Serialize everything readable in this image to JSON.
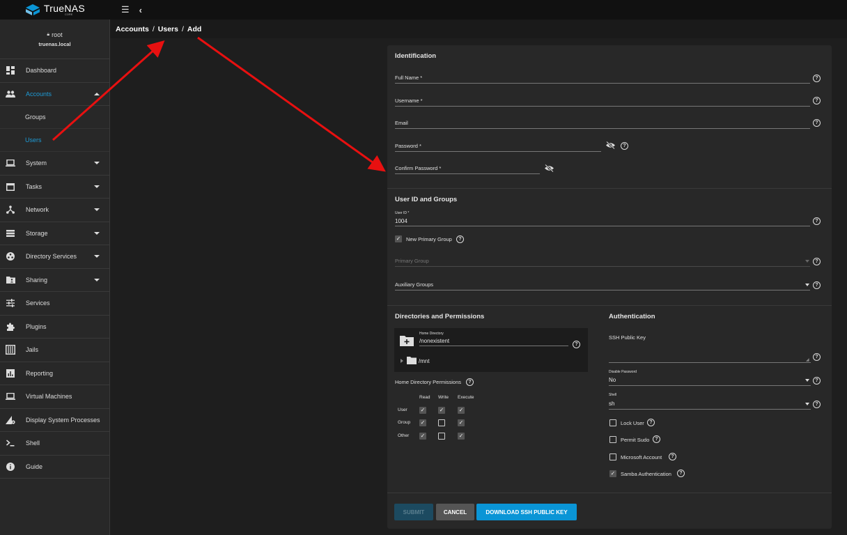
{
  "app": {
    "name": "TrueNAS",
    "edition": "CORE"
  },
  "user": {
    "name": "root",
    "host": "truenas.local"
  },
  "breadcrumb": [
    "Accounts",
    "Users",
    "Add"
  ],
  "sidebar": {
    "items": [
      {
        "label": "Dashboard",
        "icon": "dashboard-icon"
      },
      {
        "label": "Accounts",
        "icon": "people-icon",
        "expanded": true,
        "active": true
      },
      {
        "label": "System",
        "icon": "laptop-icon"
      },
      {
        "label": "Tasks",
        "icon": "calendar-icon"
      },
      {
        "label": "Network",
        "icon": "network-icon"
      },
      {
        "label": "Storage",
        "icon": "storage-icon"
      },
      {
        "label": "Directory Services",
        "icon": "directory-icon"
      },
      {
        "label": "Sharing",
        "icon": "folder-share-icon"
      },
      {
        "label": "Services",
        "icon": "tune-icon"
      },
      {
        "label": "Plugins",
        "icon": "puzzle-icon"
      },
      {
        "label": "Jails",
        "icon": "jail-icon"
      },
      {
        "label": "Reporting",
        "icon": "chart-icon"
      },
      {
        "label": "Virtual Machines",
        "icon": "monitor-icon"
      },
      {
        "label": "Display System Processes",
        "icon": "processes-icon"
      },
      {
        "label": "Shell",
        "icon": "terminal-icon"
      },
      {
        "label": "Guide",
        "icon": "info-icon"
      }
    ],
    "accounts_sub": [
      "Groups",
      "Users"
    ]
  },
  "form": {
    "identification": {
      "title": "Identification",
      "full_name": "Full Name *",
      "username": "Username *",
      "email": "Email",
      "password": "Password *",
      "confirm_password": "Confirm Password *"
    },
    "ids": {
      "title": "User ID and Groups",
      "user_id_label": "User ID *",
      "user_id_value": "1004",
      "new_primary_group": "New Primary Group",
      "primary_group": "Primary Group",
      "auxiliary_groups": "Auxiliary Groups"
    },
    "directories": {
      "title": "Directories and Permissions",
      "home_dir_label": "Home Directory",
      "home_dir_value": "/nonexistent",
      "tree_root": "/mnt",
      "perm_title": "Home Directory Permissions",
      "perm_cols": [
        "Read",
        "Write",
        "Execute"
      ],
      "perm_rows": [
        {
          "name": "User",
          "read": true,
          "write": true,
          "execute": true
        },
        {
          "name": "Group",
          "read": true,
          "write": false,
          "execute": true
        },
        {
          "name": "Other",
          "read": true,
          "write": false,
          "execute": true
        }
      ]
    },
    "auth": {
      "title": "Authentication",
      "ssh_key_label": "SSH Public Key",
      "disable_password_label": "Disable Password",
      "disable_password_value": "No",
      "shell_label": "Shell",
      "shell_value": "sh",
      "lock_user": "Lock User",
      "permit_sudo": "Permit Sudo",
      "microsoft_account": "Microsoft Account",
      "samba_auth": "Samba Authentication"
    },
    "buttons": {
      "submit": "SUBMIT",
      "cancel": "CANCEL",
      "download_ssh": "DOWNLOAD SSH PUBLIC KEY"
    }
  },
  "colors": {
    "accent": "#1e9bd6",
    "arrow": "#e81010",
    "primary_button": "#0a95d6"
  }
}
